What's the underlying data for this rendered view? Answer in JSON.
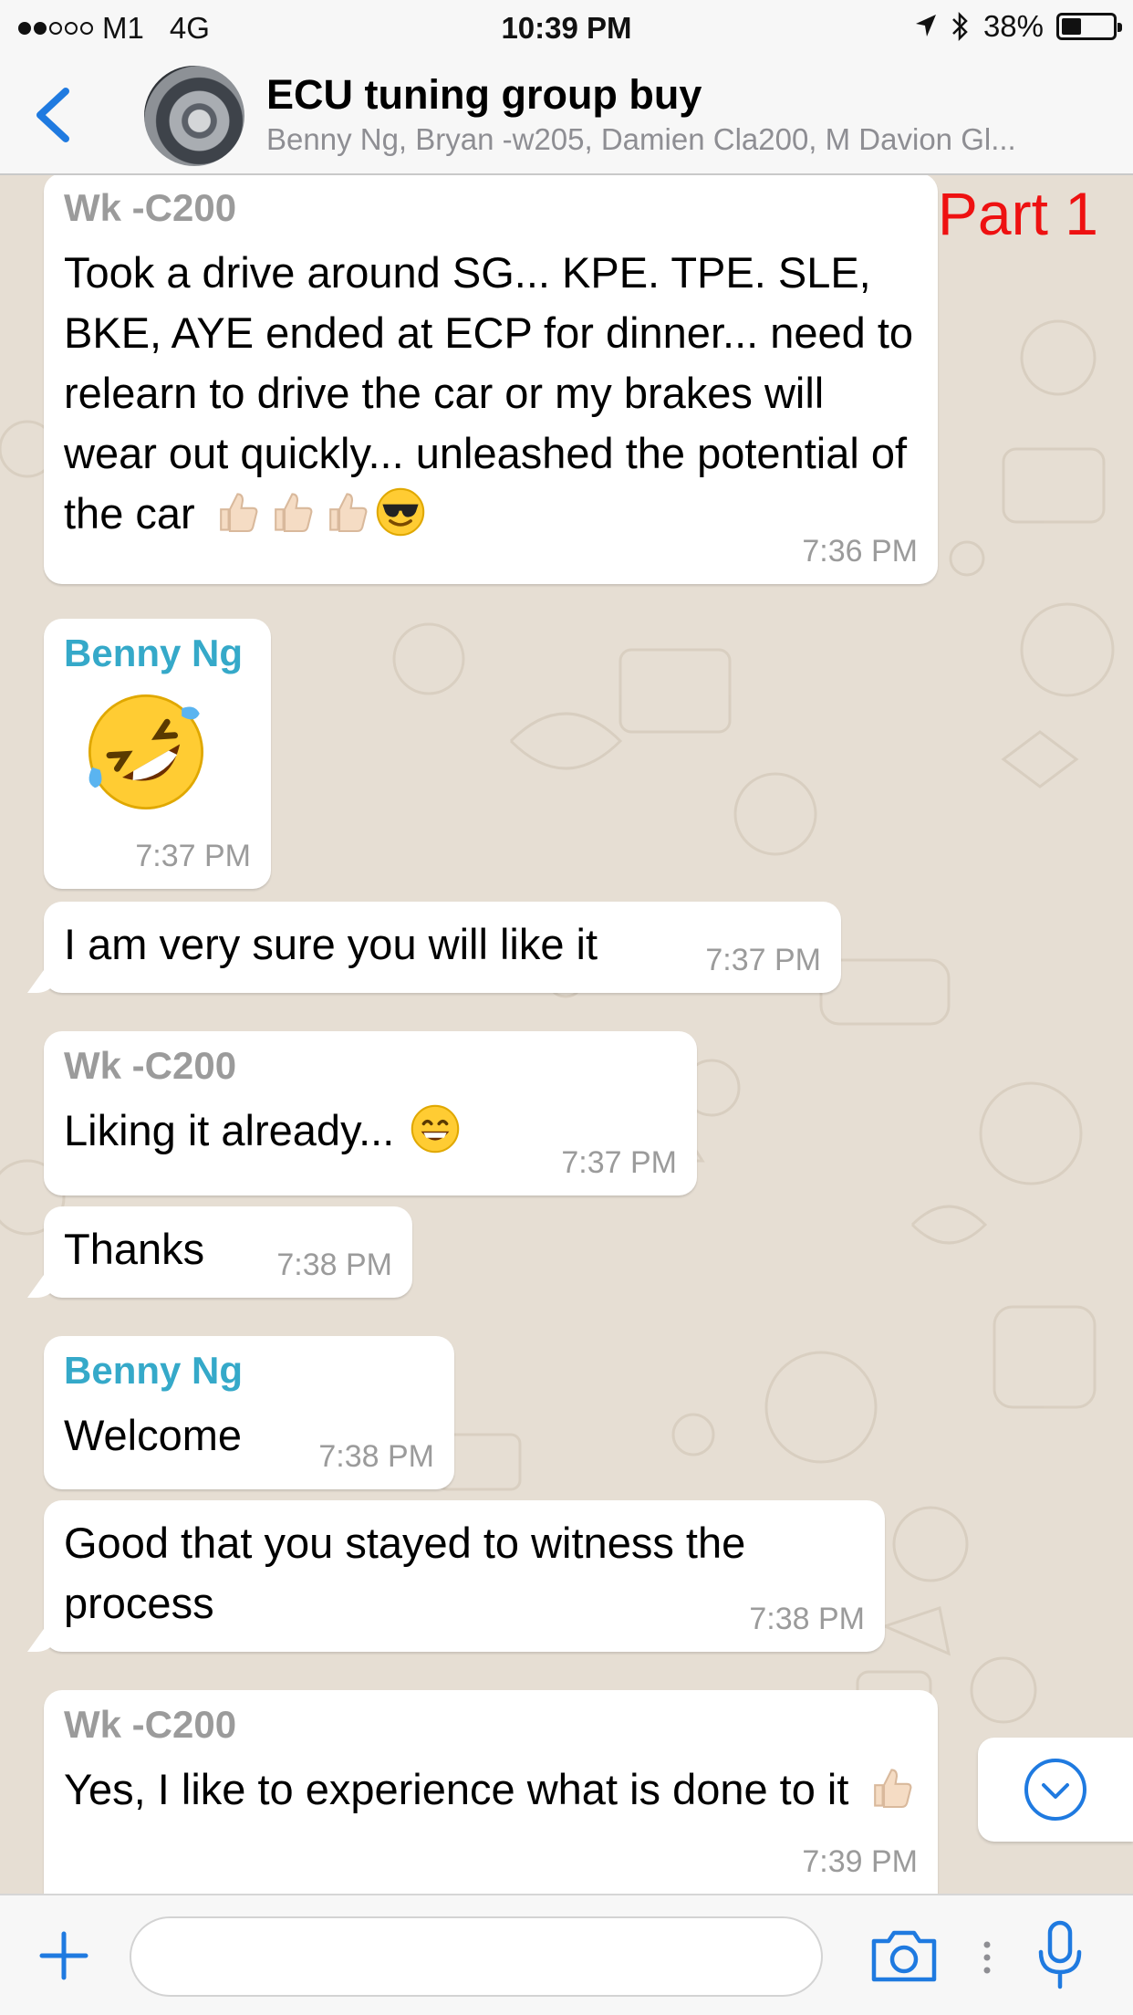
{
  "status_bar": {
    "carrier": "M1",
    "network": "4G",
    "time": "10:39 PM",
    "battery": "38%",
    "battery_level": 0.38
  },
  "header": {
    "back_icon": "chevron-left-icon",
    "title": "ECU tuning group buy",
    "members": "Benny Ng, Bryan -w205, Damien Cla200, M Davion Gl..."
  },
  "overlay_label": "Part 1",
  "messages": [
    {
      "sender": "Wk -C200",
      "text": "Took a drive around SG... KPE. TPE. SLE, BKE, AYE ended at ECP for dinner... need to relearn to drive the car or my brakes will wear out quickly... unleashed the potential of the car",
      "emojis": [
        "thumbs-up",
        "thumbs-up",
        "thumbs-up",
        "smiling-face-with-sunglasses"
      ],
      "time": "7:36 PM"
    },
    {
      "sender": "Benny Ng",
      "emoji": "rolling-on-the-floor-laughing",
      "time": "7:37 PM"
    },
    {
      "text": "I am very sure you will like it",
      "time": "7:37 PM"
    },
    {
      "sender": "Wk -C200",
      "text": "Liking it already...",
      "emojis": [
        "grinning-face-with-smiling-eyes"
      ],
      "time": "7:37 PM"
    },
    {
      "text": "Thanks",
      "time": "7:38 PM"
    },
    {
      "sender": "Benny Ng",
      "text": "Welcome",
      "time": "7:38 PM"
    },
    {
      "text": "Good that you stayed to witness the process",
      "time": "7:38 PM"
    },
    {
      "sender": "Wk -C200",
      "text": "Yes, I like to experience what is done to it",
      "emojis": [
        "thumbs-up"
      ],
      "time": "7:39 PM"
    }
  ],
  "colors": {
    "accent": "#1f7ae0",
    "sender_benny": "#35a9c9",
    "sender_wk": "#9b9b9b",
    "overlay_label": "#ee1111",
    "chat_background": "#e6ded3"
  },
  "input_bar": {
    "attach_icon": "plus-icon",
    "camera_icon": "camera-icon",
    "mic_icon": "microphone-icon"
  }
}
